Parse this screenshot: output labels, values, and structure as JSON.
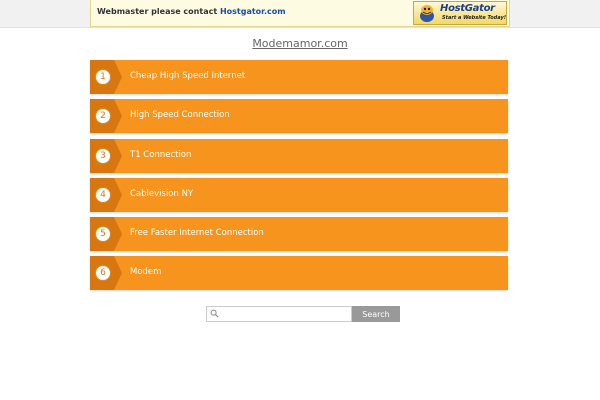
{
  "notice": {
    "text": "Webmaster please contact ",
    "link": "Hostgator.com"
  },
  "host_logo": {
    "name": "HostGator",
    "tagline": "Start a Website Today!",
    "icon": "gator-mascot-icon"
  },
  "site_title": "Modemamor.com",
  "links": [
    {
      "number": "1",
      "label": "Cheap High Speed Internet"
    },
    {
      "number": "2",
      "label": "High Speed Connection"
    },
    {
      "number": "3",
      "label": "T1 Connection"
    },
    {
      "number": "4",
      "label": "Cablevision NY"
    },
    {
      "number": "5",
      "label": "Free Faster Internet Connection"
    },
    {
      "number": "6",
      "label": "Modem"
    }
  ],
  "search": {
    "placeholder": "",
    "button_label": "Search",
    "icon": "search-icon"
  },
  "colors": {
    "item_bg": "#f7941d",
    "item_badge": "#d8770f",
    "search_button": "#999999"
  }
}
